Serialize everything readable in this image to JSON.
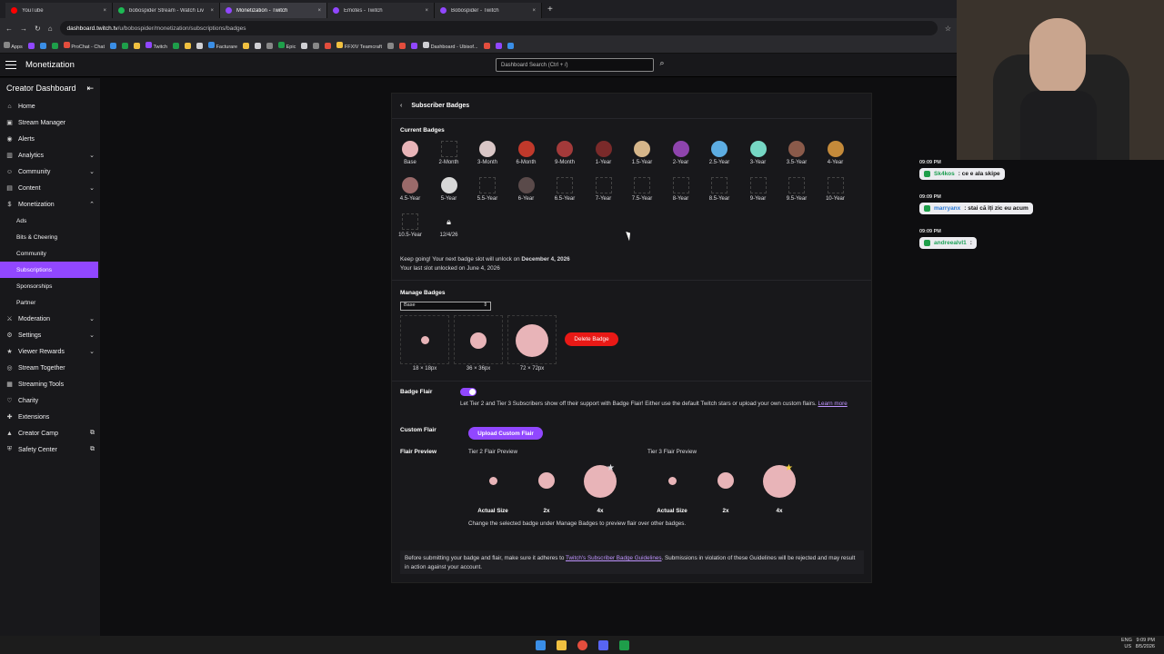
{
  "browser": {
    "tabs": [
      {
        "label": "YouTube",
        "color": "#ff0000"
      },
      {
        "label": "bobospider Stream - Watch Liv",
        "color": "#1db954"
      },
      {
        "label": "Monetization - Twitch",
        "color": "#9147ff",
        "active": true
      },
      {
        "label": "Emotes - Twitch",
        "color": "#9147ff"
      },
      {
        "label": "Bobospider - Twitch",
        "color": "#9147ff"
      }
    ],
    "url_domain": "dashboard.twitch.tv",
    "url_path": "/u/bobospider/monetization/subscriptions/badges",
    "bookmarks": [
      "Apps",
      "ProChat - Chat",
      "Twitch",
      "Facturare",
      "Epic",
      "FFXIV Teamcraft",
      "Dashboard - Ubisof..."
    ]
  },
  "topnav": {
    "title": "Monetization",
    "search_placeholder": "Dashboard Search (Ctrl + /)"
  },
  "sidebar": {
    "title": "Creator Dashboard",
    "items": [
      {
        "label": "Home",
        "icon": "home-icon",
        "glyph": "⌂"
      },
      {
        "label": "Stream Manager",
        "icon": "stream-manager-icon",
        "glyph": "▣"
      },
      {
        "label": "Alerts",
        "icon": "alerts-icon",
        "glyph": "◉"
      },
      {
        "label": "Analytics",
        "icon": "analytics-icon",
        "glyph": "▥",
        "chevron": "⌄"
      },
      {
        "label": "Community",
        "icon": "community-icon",
        "glyph": "☺",
        "chevron": "⌄"
      },
      {
        "label": "Content",
        "icon": "content-icon",
        "glyph": "▤",
        "chevron": "⌄"
      },
      {
        "label": "Monetization",
        "icon": "monetization-icon",
        "glyph": "$",
        "chevron": "⌃"
      }
    ],
    "sub_items": [
      "Ads",
      "Bits & Cheering",
      "Community",
      "Subscriptions",
      "Sponsorships",
      "Partner"
    ],
    "items2": [
      {
        "label": "Moderation",
        "icon": "moderation-icon",
        "glyph": "⚔",
        "chevron": "⌄"
      },
      {
        "label": "Settings",
        "icon": "settings-icon",
        "glyph": "⚙",
        "chevron": "⌄"
      },
      {
        "label": "Viewer Rewards",
        "icon": "rewards-icon",
        "glyph": "★",
        "chevron": "⌄"
      },
      {
        "label": "Stream Together",
        "icon": "stream-together-icon",
        "glyph": "◎"
      },
      {
        "label": "Streaming Tools",
        "icon": "streaming-tools-icon",
        "glyph": "▦"
      },
      {
        "label": "Charity",
        "icon": "charity-icon",
        "glyph": "♡"
      },
      {
        "label": "Extensions",
        "icon": "extensions-icon",
        "glyph": "✚"
      },
      {
        "label": "Creator Camp",
        "icon": "creator-camp-icon",
        "glyph": "▲",
        "chevron": "⧉"
      },
      {
        "label": "Safety Center",
        "icon": "safety-center-icon",
        "glyph": "⛨",
        "chevron": "⧉"
      }
    ]
  },
  "page": {
    "title": "Subscriber Badges",
    "current_badges_label": "Current Badges",
    "badges": [
      {
        "label": "Base",
        "filled": true,
        "color": "#e8b4b8"
      },
      {
        "label": "2-Month",
        "filled": false
      },
      {
        "label": "3-Month",
        "filled": true,
        "color": "#d9c6c6"
      },
      {
        "label": "6-Month",
        "filled": true,
        "color": "#c0392b"
      },
      {
        "label": "9-Month",
        "filled": true,
        "color": "#a33a3a"
      },
      {
        "label": "1-Year",
        "filled": true,
        "color": "#7a2a2a"
      },
      {
        "label": "1.5-Year",
        "filled": true,
        "color": "#d6b68a"
      },
      {
        "label": "2-Year",
        "filled": true,
        "color": "#8e44ad"
      },
      {
        "label": "2.5-Year",
        "filled": true,
        "color": "#5dade2"
      },
      {
        "label": "3-Year",
        "filled": true,
        "color": "#76d7c4"
      },
      {
        "label": "3.5-Year",
        "filled": true,
        "color": "#8a5a4a"
      },
      {
        "label": "4-Year",
        "filled": true,
        "color": "#c48a3a"
      },
      {
        "label": "4.5-Year",
        "filled": true,
        "color": "#9a6a6a"
      },
      {
        "label": "5-Year",
        "filled": true,
        "color": "#d8d8d8"
      },
      {
        "label": "5.5-Year",
        "filled": false
      },
      {
        "label": "6-Year",
        "filled": true,
        "color": "#5a4a4a"
      },
      {
        "label": "6.5-Year",
        "filled": false
      },
      {
        "label": "7-Year",
        "filled": false
      },
      {
        "label": "7.5-Year",
        "filled": false
      },
      {
        "label": "8-Year",
        "filled": false
      },
      {
        "label": "8.5-Year",
        "filled": false
      },
      {
        "label": "9-Year",
        "filled": false
      },
      {
        "label": "9.5-Year",
        "filled": false
      },
      {
        "label": "10-Year",
        "filled": false
      },
      {
        "label": "10.5-Year",
        "filled": false
      },
      {
        "label": "12/4/26",
        "filled": false,
        "locked": true
      }
    ],
    "unlock_line1": "Keep going! Your next badge slot will unlock on ",
    "unlock_date": "December 4, 2026",
    "unlock_line2": "Your last slot unlocked on June 4, 2026",
    "manage_label": "Manage Badges",
    "select_value": "Base",
    "sizes": [
      "18 × 18px",
      "36 × 36px",
      "72 × 72px"
    ],
    "delete_label": "Delete Badge",
    "flair_label": "Badge Flair",
    "flair_desc": "Let Tier 2 and Tier 3 Subscribers show off their support with Badge Flair! Either use the default Twitch stars or upload your own custom flairs. ",
    "flair_link": "Learn more",
    "custom_flair_label": "Custom Flair",
    "upload_label": "Upload Custom Flair",
    "flair_preview_label": "Flair Preview",
    "tier2_label": "Tier 2 Flair Preview",
    "tier3_label": "Tier 3 Flair Preview",
    "preview_sizes": [
      "Actual Size",
      "2x",
      "4x"
    ],
    "preview_note": "Change the selected badge under Manage Badges to preview flair over other badges.",
    "notice_pre": "Before submitting your badge and flair, make sure it adheres to ",
    "notice_link": "Twitch's Subscriber Badge Guidelines",
    "notice_post": ". Submissions in violation of these Guidelines will be rejected and may result in action against your account."
  },
  "chat": [
    {
      "time": "09:09 PM",
      "name": "Sk4kos",
      "text": ": ce e ala skipe"
    },
    {
      "time": "09:09 PM",
      "name": "marryanx",
      "text": ": stai că îți zic eu acum"
    },
    {
      "time": "09:09 PM",
      "name": "andreealvl1",
      "text": ":"
    }
  ],
  "taskbar": {
    "lang": "ENG",
    "region": "US",
    "time": "9:09 PM",
    "date": "8/5/2026"
  }
}
